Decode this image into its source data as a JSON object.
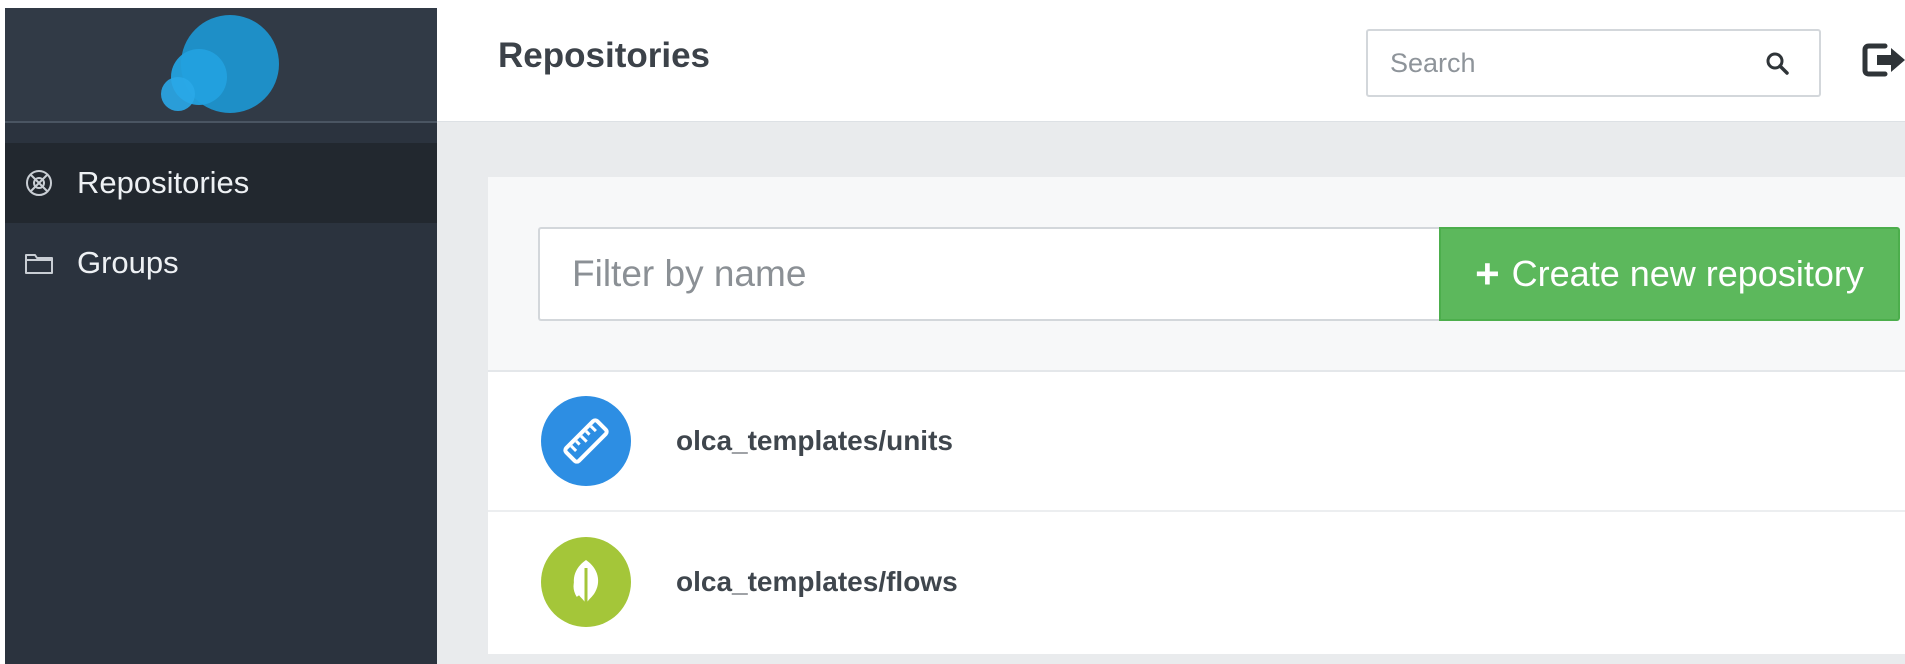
{
  "header": {
    "title": "Repositories",
    "search_placeholder": "Search"
  },
  "sidebar": {
    "items": [
      {
        "label": "Repositories",
        "icon": "repositories-icon",
        "active": true
      },
      {
        "label": "Groups",
        "icon": "folder-icon",
        "active": false
      }
    ]
  },
  "main": {
    "filter_placeholder": "Filter by name",
    "create_button_label": "Create new repository",
    "repositories": [
      {
        "name": "olca_templates/units",
        "icon": "ruler-icon",
        "color": "#2d8ee3"
      },
      {
        "name": "olca_templates/flows",
        "icon": "leaf-icon",
        "color": "#a4c639"
      }
    ]
  },
  "colors": {
    "sidebar_bg": "#2b333e",
    "accent_green": "#5cb85c",
    "logo_blue": "#1e8fc7"
  }
}
